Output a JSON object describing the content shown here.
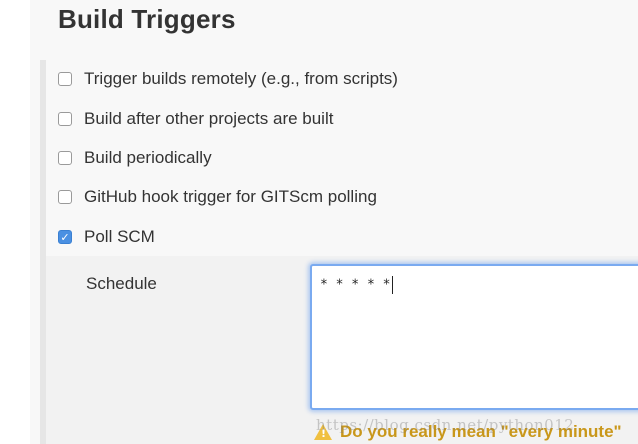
{
  "section": {
    "title": "Build Triggers"
  },
  "triggers": [
    {
      "label": "Trigger builds remotely (e.g., from scripts)",
      "checked": false
    },
    {
      "label": "Build after other projects are built",
      "checked": false
    },
    {
      "label": "Build periodically",
      "checked": false
    },
    {
      "label": "GitHub hook trigger for GITScm polling",
      "checked": false
    },
    {
      "label": "Poll SCM",
      "checked": true
    }
  ],
  "schedule": {
    "label": "Schedule",
    "value": "* * * * *"
  },
  "warning": {
    "icon": "warning-icon",
    "text": "Do you really mean \"every minute\""
  },
  "watermark": {
    "text": "https://blog.csdn.net/python012"
  },
  "colors": {
    "accent": "#4a90e2",
    "warning": "#c9971a"
  }
}
